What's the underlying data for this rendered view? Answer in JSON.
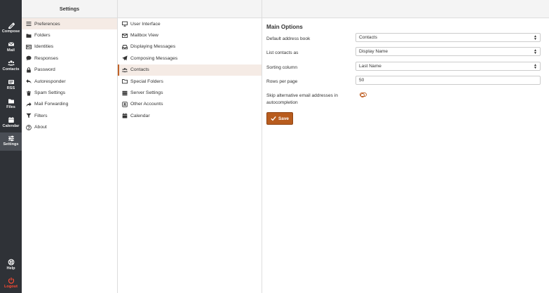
{
  "rail": {
    "items": [
      {
        "label": "Compose",
        "icon": "compose-icon"
      },
      {
        "label": "Mail",
        "icon": "mail-icon"
      },
      {
        "label": "Contacts",
        "icon": "contacts-icon"
      },
      {
        "label": "RSS",
        "icon": "rss-icon"
      },
      {
        "label": "Files",
        "icon": "folder-icon"
      },
      {
        "label": "Calendar",
        "icon": "calendar-icon"
      },
      {
        "label": "Settings",
        "icon": "settings-icon"
      }
    ],
    "help_label": "Help",
    "logout_label": "Logout"
  },
  "settings": {
    "title": "Settings",
    "items": [
      {
        "label": "Preferences",
        "icon": "sliders-icon"
      },
      {
        "label": "Folders",
        "icon": "folder-icon"
      },
      {
        "label": "Identities",
        "icon": "id-card-icon"
      },
      {
        "label": "Responses",
        "icon": "speech-bubble-icon"
      },
      {
        "label": "Password",
        "icon": "lock-icon"
      },
      {
        "label": "Autoresponder",
        "icon": "reply-icon"
      },
      {
        "label": "Spam Settings",
        "icon": "trash-icon"
      },
      {
        "label": "Mail Forwarding",
        "icon": "forward-icon"
      },
      {
        "label": "Filters",
        "icon": "filter-icon"
      },
      {
        "label": "About",
        "icon": "question-icon"
      }
    ]
  },
  "sections": {
    "items": [
      {
        "label": "User Interface",
        "icon": "monitor-icon"
      },
      {
        "label": "Mailbox View",
        "icon": "envelope-icon"
      },
      {
        "label": "Displaying Messages",
        "icon": "inbox-icon"
      },
      {
        "label": "Composing Messages",
        "icon": "paper-plane-icon"
      },
      {
        "label": "Contacts",
        "icon": "users-icon"
      },
      {
        "label": "Special Folders",
        "icon": "folder-outline-icon"
      },
      {
        "label": "Server Settings",
        "icon": "server-icon"
      },
      {
        "label": "Other Accounts",
        "icon": "accounts-icon"
      },
      {
        "label": "Calendar",
        "icon": "calendar-icon"
      }
    ]
  },
  "main": {
    "title": "Main Options",
    "default_address_book": {
      "label": "Default address book",
      "value": "Contacts"
    },
    "list_contacts_as": {
      "label": "List contacts as",
      "value": "Display Name"
    },
    "sorting_column": {
      "label": "Sorting column",
      "value": "Last Name"
    },
    "rows_per_page": {
      "label": "Rows per page",
      "value": "50"
    },
    "skip_alt_email": {
      "label": "Skip alternative email addresses in autocompletion",
      "checked": false
    },
    "save_label": "Save"
  },
  "colors": {
    "accent": "#b85c1e",
    "rail_bg": "#2f3237",
    "logout": "#ff4b33",
    "selected_bg": "#f5ebe5"
  }
}
